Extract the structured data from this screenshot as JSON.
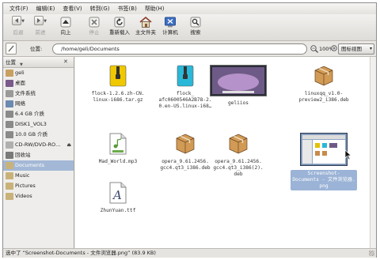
{
  "menubar": {
    "items": [
      "文件(F)",
      "编辑(E)",
      "查看(V)",
      "转到(G)",
      "书签(B)",
      "帮助(H)"
    ]
  },
  "toolbar": {
    "back": "后退",
    "forward": "前进",
    "up": "向上",
    "stop": "停止",
    "reload": "重新载入",
    "home": "主文件夹",
    "computer": "计算机",
    "search": "搜索"
  },
  "location": {
    "label": "位置:",
    "path": "/home/geli/Documents",
    "zoom": "100%",
    "view_mode": "图标视图"
  },
  "sidebar": {
    "header": "位置",
    "items": [
      {
        "label": "geli",
        "icon": "home-folder-icon",
        "color": "#c8a060"
      },
      {
        "label": "桌面",
        "icon": "desktop-icon",
        "color": "#7a5a8a"
      },
      {
        "label": "文件系统",
        "icon": "filesystem-icon",
        "color": "#9a9a9a"
      },
      {
        "label": "网络",
        "icon": "network-icon",
        "color": "#6a8ab0"
      },
      {
        "label": "6.4 GB 介质",
        "icon": "drive-icon",
        "color": "#8a8a8a"
      },
      {
        "label": "DISK1_VOL3",
        "icon": "drive-icon",
        "color": "#8a8a8a"
      },
      {
        "label": "10.0 GB 介质",
        "icon": "drive-icon",
        "color": "#8a8a8a"
      },
      {
        "label": "CD-RW/DVD-RO…",
        "icon": "optical-drive-icon",
        "color": "#b0b0b0"
      },
      {
        "label": "回收站",
        "icon": "trash-icon",
        "color": "#7a7a7a"
      },
      {
        "label": "Documents",
        "icon": "folder-icon",
        "color": "#c9b27a"
      },
      {
        "label": "Music",
        "icon": "folder-icon",
        "color": "#c9b27a"
      },
      {
        "label": "Pictures",
        "icon": "folder-icon",
        "color": "#c9b27a"
      },
      {
        "label": "Videos",
        "icon": "folder-icon",
        "color": "#c9b27a"
      }
    ],
    "selected_index": 9
  },
  "files": [
    {
      "name": "flock-1.2.6.zh-CN.\nlinux-i686.tar.gz",
      "icon": "archive-icon"
    },
    {
      "name": "flock_\nafc0600546A2B78-2.\n0.en-US.linux-i68…",
      "icon": "archive-icon"
    },
    {
      "name": "geliios",
      "icon": "image-thumbnail-icon"
    },
    {
      "name": "linuxqq_v1.0-\npreview2_i386.deb",
      "icon": "package-icon"
    },
    {
      "name": "Mad_World.mp3",
      "icon": "audio-file-icon"
    },
    {
      "name": "opera_9.61.2456.\ngcc4.qt3_i386.deb",
      "icon": "package-icon"
    },
    {
      "name": "opera_9.61.2456.\ngcc4.qt3_i386(2).\ndeb",
      "icon": "package-icon"
    },
    {
      "name": "Screenshot-\nDocuments - 文件浏览器.\npng",
      "icon": "screenshot-thumbnail-icon"
    },
    {
      "name": "ZhunYuan.ttf",
      "icon": "font-file-icon"
    }
  ],
  "status": {
    "text": "选中了 “Screenshot-Documents - 文件浏览器.png” (83.9 KB)"
  },
  "colors": {
    "selection": "#9bb3d6",
    "archive_yellow": "#f0c800",
    "archive_cyan": "#2ab8d8",
    "package_brown": "#c98a4a"
  }
}
